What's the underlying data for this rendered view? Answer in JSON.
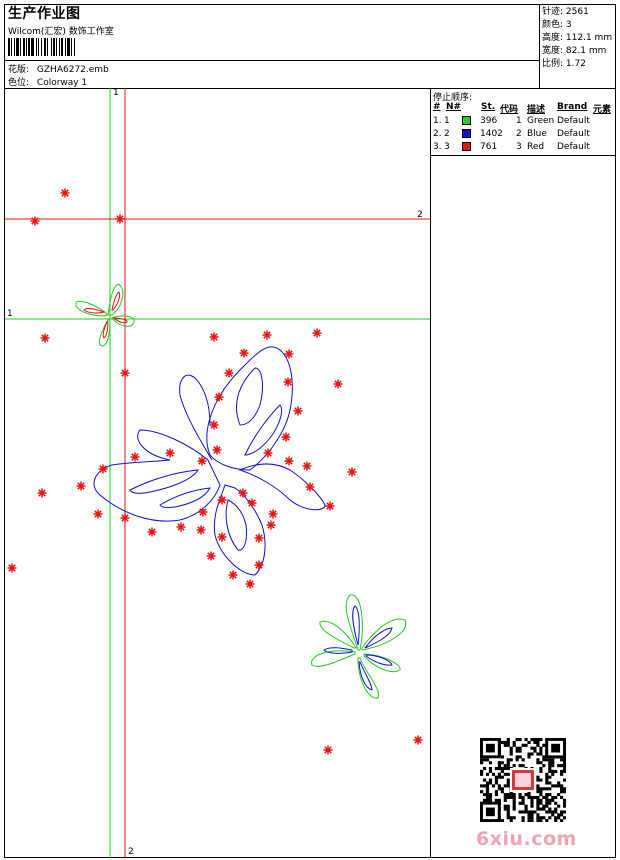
{
  "header": {
    "title": "生产作业图",
    "subtitle": "Wilcom(汇宏) 数饰工作室",
    "design_label": "花版:",
    "design_value": "GZHA6272.emb",
    "colorway_label": "色位:",
    "colorway_value": "Colorway 1"
  },
  "stats": [
    {
      "label": "针迹:",
      "value": "2561"
    },
    {
      "label": "颜色:",
      "value": "3"
    },
    {
      "label": "高度:",
      "value": "112.1 mm"
    },
    {
      "label": "宽度:",
      "value": "82.1 mm"
    },
    {
      "label": "比例:",
      "value": "1.72"
    }
  ],
  "stop_sequence": {
    "title": "停止顺序:",
    "headers": [
      "#",
      "N#",
      "St.",
      "代码",
      "描述",
      "Brand",
      "元素"
    ],
    "rows": [
      {
        "num": "1.",
        "n": "1",
        "color": "#22cc22",
        "st": "396",
        "code": "1",
        "desc": "Green",
        "brand": "Default"
      },
      {
        "num": "2.",
        "n": "2",
        "color": "#1111cc",
        "st": "1402",
        "code": "2",
        "desc": "Blue",
        "brand": "Default"
      },
      {
        "num": "3.",
        "n": "3",
        "color": "#ee1111",
        "st": "761",
        "code": "3",
        "desc": "Red",
        "brand": "Default"
      }
    ]
  },
  "guides": {
    "green_vertical_label": "1",
    "green_horizontal_label": "1",
    "red_horizontal_label": "2",
    "red_vertical_label": "2"
  },
  "colors": {
    "green": "#22cc22",
    "blue": "#1111cc",
    "red": "#ee1111"
  },
  "watermark": "6xiu.com"
}
